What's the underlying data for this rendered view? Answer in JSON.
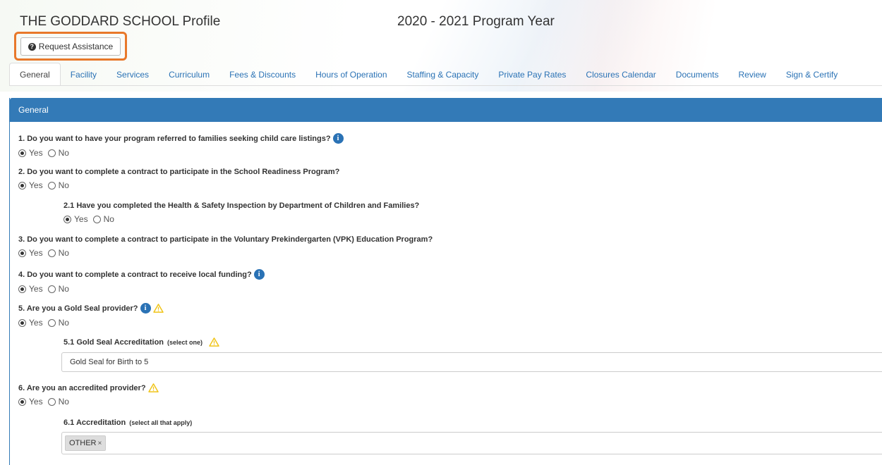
{
  "header": {
    "school_title": "THE GODDARD SCHOOL Profile",
    "program_year": "2020 - 2021 Program Year",
    "assist_label": "Request Assistance"
  },
  "tabs": [
    {
      "label": "General",
      "active": true
    },
    {
      "label": "Facility"
    },
    {
      "label": "Services"
    },
    {
      "label": "Curriculum"
    },
    {
      "label": "Fees & Discounts"
    },
    {
      "label": "Hours of Operation"
    },
    {
      "label": "Staffing & Capacity"
    },
    {
      "label": "Private Pay Rates"
    },
    {
      "label": "Closures Calendar"
    },
    {
      "label": "Documents"
    },
    {
      "label": "Review"
    },
    {
      "label": "Sign & Certify"
    }
  ],
  "panel": {
    "heading": "General",
    "yes": "Yes",
    "no": "No",
    "questions": {
      "q1": {
        "label": "1. Do you want to have your program referred to families seeking child care listings?",
        "selected": "Yes"
      },
      "q2": {
        "label": "2. Do you want to complete a contract to participate in the School Readiness Program?",
        "selected": "Yes"
      },
      "q2_1": {
        "label": "2.1 Have you completed the Health & Safety Inspection by Department of Children and Families?",
        "selected": "Yes"
      },
      "q3": {
        "label": "3. Do you want to complete a contract to participate in the Voluntary Prekindergarten (VPK) Education Program?",
        "selected": "Yes"
      },
      "q4": {
        "label": "4. Do you want to complete a contract to receive local funding?",
        "selected": "Yes"
      },
      "q5": {
        "label": "5. Are you a Gold Seal provider?",
        "selected": "Yes"
      },
      "q5_1": {
        "label": "5.1 Gold Seal Accreditation",
        "hint": "(select one)",
        "value": "Gold Seal for Birth to 5"
      },
      "q6": {
        "label": "6. Are you an accredited provider?",
        "selected": "Yes"
      },
      "q6_1": {
        "label": "6.1 Accreditation",
        "hint": "(select all that apply)",
        "chips": [
          "OTHER"
        ],
        "chip_remove": "×"
      }
    }
  },
  "icons": {
    "info": "i",
    "help": "?",
    "accent_blue": "#337ab7",
    "highlight_orange": "#e8782a",
    "warning_yellow": "#f0c419"
  }
}
